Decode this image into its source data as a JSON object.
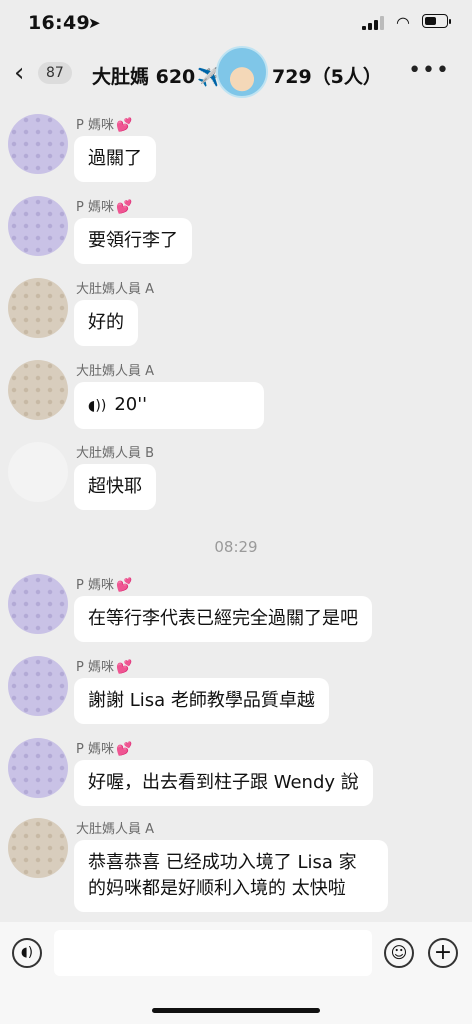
{
  "status": {
    "time": "16:49",
    "location_icon": "location-arrow-icon",
    "wifi_icon": "wifi-icon",
    "battery_level": 0.6
  },
  "header": {
    "unread_count": "87",
    "title_part1": "大肚媽 620",
    "title_plane_icon": "✈️",
    "title_part2": "729（5人）",
    "more_icon": "more-icon"
  },
  "messages": [
    {
      "sender": "P 媽咪",
      "heart": "💕",
      "text": "過關了"
    },
    {
      "sender": "P 媽咪",
      "heart": "💕",
      "text": "要領行李了"
    },
    {
      "sender": "大肚媽人員 A",
      "heart": "",
      "text": "好的"
    },
    {
      "sender": "大肚媽人員 A",
      "heart": "",
      "text": "20''",
      "voice_icon": "🔊"
    },
    {
      "sender": "大肚媽人員 B",
      "heart": "",
      "text": "超快耶"
    },
    {
      "sender": "P 媽咪",
      "heart": "💕",
      "text": "在等行李代表已經完全過關了是吧"
    },
    {
      "sender": "P 媽咪",
      "heart": "💕",
      "text": "謝謝 Lisa 老師教學品質卓越"
    },
    {
      "sender": "P 媽咪",
      "heart": "💕",
      "text": "好喔，出去看到柱子跟 Wendy 說"
    },
    {
      "sender": "大肚媽人員 A",
      "heart": "",
      "text": "恭喜恭喜 已经成功入境了 Lisa 家的妈咪都是好顺利入境的 太快啦"
    }
  ],
  "timestamp": "08:29",
  "input": {
    "placeholder": "",
    "voice_icon": "voice-icon",
    "emoji_icon": "emoji-icon",
    "plus_icon": "plus-icon"
  }
}
